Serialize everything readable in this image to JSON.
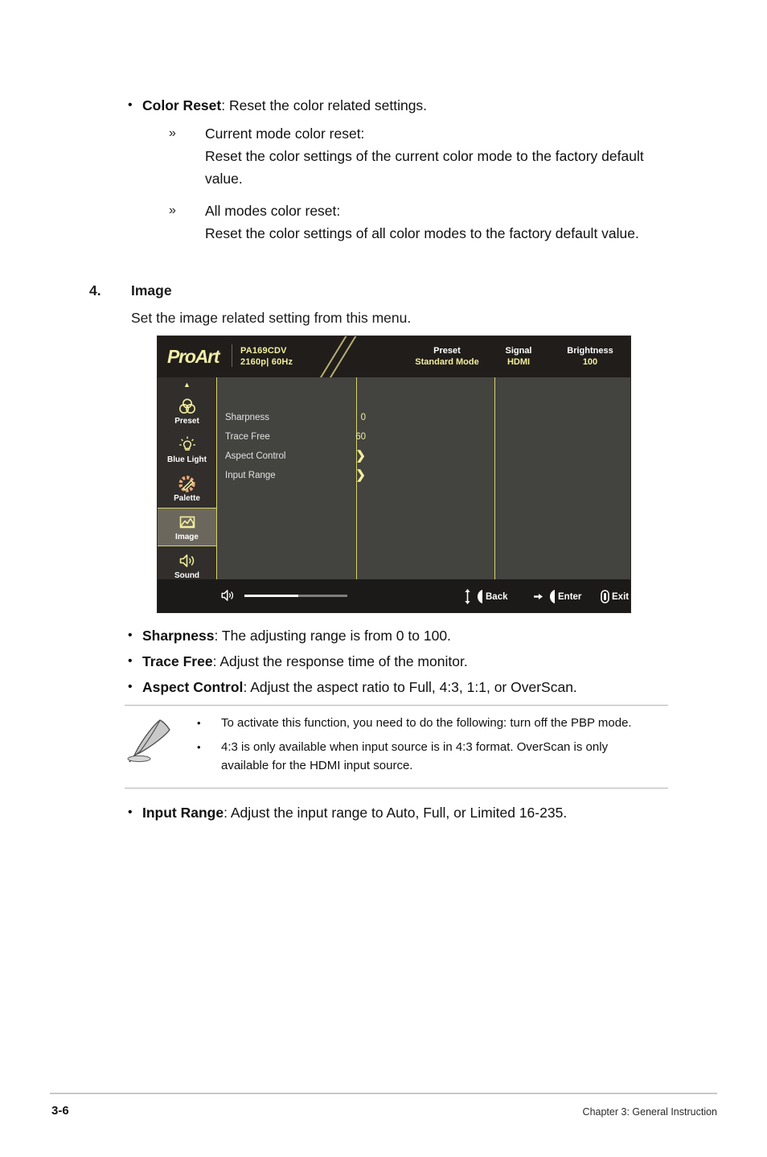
{
  "doc": {
    "color_reset": {
      "bullet": "•",
      "title": "Color Reset",
      "desc": ": Reset the color related settings.",
      "sub_items": [
        {
          "marker": "»",
          "heading": "Current mode color reset:",
          "body": "Reset the color settings of the current color mode to the factory default value."
        },
        {
          "marker": "»",
          "heading": "All modes color reset:",
          "body": "Reset the color settings of all color modes to the factory default value."
        }
      ]
    },
    "section": {
      "number": "4.",
      "title": "Image",
      "intro": "Set the image related setting from this menu."
    },
    "feature_bullets": [
      {
        "bullet": "•",
        "term": "Sharpness",
        "desc": ": The adjusting range is from 0 to 100."
      },
      {
        "bullet": "•",
        "term": "Trace Free",
        "desc": ": Adjust the response time of the monitor."
      },
      {
        "bullet": "•",
        "term": "Aspect Control",
        "desc": ": Adjust the aspect ratio to Full, 4:3, 1:1, or OverScan."
      }
    ],
    "note": {
      "icon_name": "quill-pen-icon",
      "items": [
        {
          "bullet": "•",
          "text": "To activate this function, you need to do the following: turn off the PBP mode."
        },
        {
          "bullet": "•",
          "text": "4:3 is only available when input source is in 4:3 format. OverScan is only available for the HDMI input source."
        }
      ]
    },
    "input_range_bullet": {
      "bullet": "•",
      "term": "Input Range",
      "desc": ": Adjust the input range to Auto, Full, or Limited 16-235."
    },
    "footer": {
      "page_number": "3-6",
      "chapter": "Chapter 3: General Instruction"
    }
  },
  "osd": {
    "header": {
      "brand": "ProArt",
      "model": "PA169CDV",
      "resolution": "2160p",
      "separator": "|",
      "refresh": "60Hz",
      "groups": [
        {
          "label": "Preset",
          "value": "Standard Mode"
        },
        {
          "label": "Signal",
          "value": "HDMI"
        },
        {
          "label": "Brightness",
          "value": "100"
        }
      ]
    },
    "sidebar": {
      "scroll_up": "▲",
      "scroll_down": "▼",
      "items": [
        {
          "label": "Preset",
          "icon": "venn-circles-icon",
          "active": false
        },
        {
          "label": "Blue Light",
          "icon": "lightbulb-icon",
          "active": false
        },
        {
          "label": "Palette",
          "icon": "palette-brush-icon",
          "active": false
        },
        {
          "label": "Image",
          "icon": "picture-icon",
          "active": true
        },
        {
          "label": "Sound",
          "icon": "speaker-icon",
          "active": false
        }
      ]
    },
    "menu": [
      {
        "name": "Sharpness",
        "value": "0",
        "type": "value"
      },
      {
        "name": "Trace Free",
        "value": "60",
        "type": "value"
      },
      {
        "name": "Aspect Control",
        "value": "❯",
        "type": "submenu"
      },
      {
        "name": "Input Range",
        "value": "❯",
        "type": "submenu"
      }
    ],
    "footer": {
      "volume_icon": "speaker-icon",
      "volume_percent": 52,
      "buttons": [
        {
          "label": "Back",
          "icon": "updown-joystick-icon"
        },
        {
          "label": "Enter",
          "icon": "right-joystick-icon"
        },
        {
          "label": "Exit",
          "icon": "power-pill-icon"
        }
      ]
    },
    "colors": {
      "accent_yellow": "#f2ef9d",
      "header_bg": "#201d1b",
      "panel_bg": "#434340",
      "sidebar_bg": "#312e2c",
      "active_bg": "#6b675d",
      "divider": "#d9d36a",
      "palette_orange": "#f0a878"
    }
  }
}
